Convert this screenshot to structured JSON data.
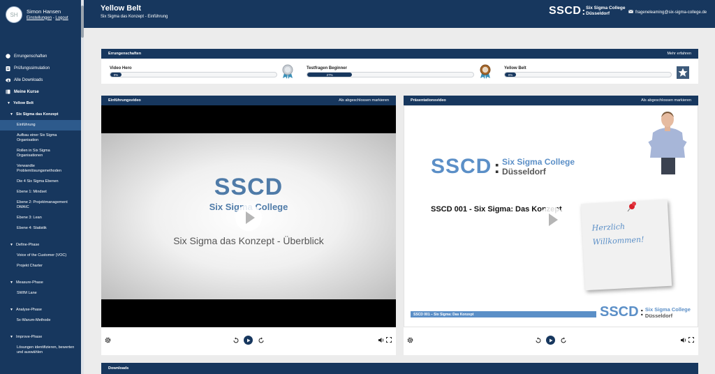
{
  "user": {
    "initials": "SH",
    "name": "Simon Hansen",
    "settings_label": "Einstellungen",
    "separator": " - ",
    "logout_label": "Logout"
  },
  "nav": {
    "achievements": "Errungenschaften",
    "exam": "Prüfungssimulation",
    "downloads": "Alle Downloads",
    "courses": "Meine Kurse",
    "yellow_belt": "Yellow Belt",
    "sections": [
      {
        "title": "Six Sigma das Konzept",
        "items": [
          "Einführung",
          "Aufbau einer Six Sigma Organisation",
          "Rollen in Six Sigma Organisationen",
          "Verwandte Problemlösungsmethoden",
          "Die 4 Six Sigma Ebenen",
          "Ebene 1: Mindset",
          "Ebene 2: Projektmanagement DMAIC",
          "Ebene 3: Lean",
          "Ebene 4: Statistik"
        ]
      },
      {
        "title": "Define-Phase",
        "items": [
          "Voice of the Customer (VOC)",
          "Projekt Charter"
        ]
      },
      {
        "title": "Measure-Phase",
        "items": [
          "SWIM Lane"
        ]
      },
      {
        "title": "Analyse-Phase",
        "items": [
          "5x-Warum-Methode"
        ]
      },
      {
        "title": "Improve-Phase",
        "items": [
          "Lösungen identifizieren, bewerten und auswählen"
        ]
      }
    ]
  },
  "header": {
    "title": "Yellow Belt",
    "subtitle": "Six Sigma das Konzept - Einführung",
    "brand_big": "SSCD",
    "brand_colon": ":",
    "brand_line1": "Six Sigma College",
    "brand_line2": "Düsseldorf",
    "email": "frageneleaming@six-sigma-college.de"
  },
  "achievements": {
    "title": "Errungenschaften",
    "more": "Mehr erfahren",
    "items": [
      {
        "label": "Video Hero",
        "progress": 0,
        "text": "0%"
      },
      {
        "label": "Testfragen Beginner",
        "progress": 27,
        "text": "27%"
      },
      {
        "label": "Yellow Belt",
        "progress": 0,
        "text": "0%"
      }
    ]
  },
  "video1": {
    "title": "Einführungsvideo",
    "mark": "Als abgeschlossen markieren",
    "logo": "SSCD",
    "logo_sub": "Six Sigma College",
    "caption": "Six Sigma das Konzept - Überblick"
  },
  "video2": {
    "title": "Präsentationsvideo",
    "mark": "Als abgeschlossen markieren",
    "logo": "SSCD",
    "logo_colon": ":",
    "logo_line1": "Six Sigma College",
    "logo_line2": "Düsseldorf",
    "heading": "SSCD 001 - Six Sigma: Das Konzept",
    "note_line1": "Herzlich",
    "note_line2": "Willkommen!",
    "footer_bar": "SSCD 001 – Six Sigma: Das Konzept",
    "footer_logo": "SSCD",
    "footer_line1": "Six Sigma College",
    "footer_line2": "Düsseldorf"
  },
  "downloads": {
    "title": "Downloads"
  },
  "colors": {
    "navy": "#17375e",
    "accent": "#5b8fc7",
    "active": "#2d5a8c"
  }
}
